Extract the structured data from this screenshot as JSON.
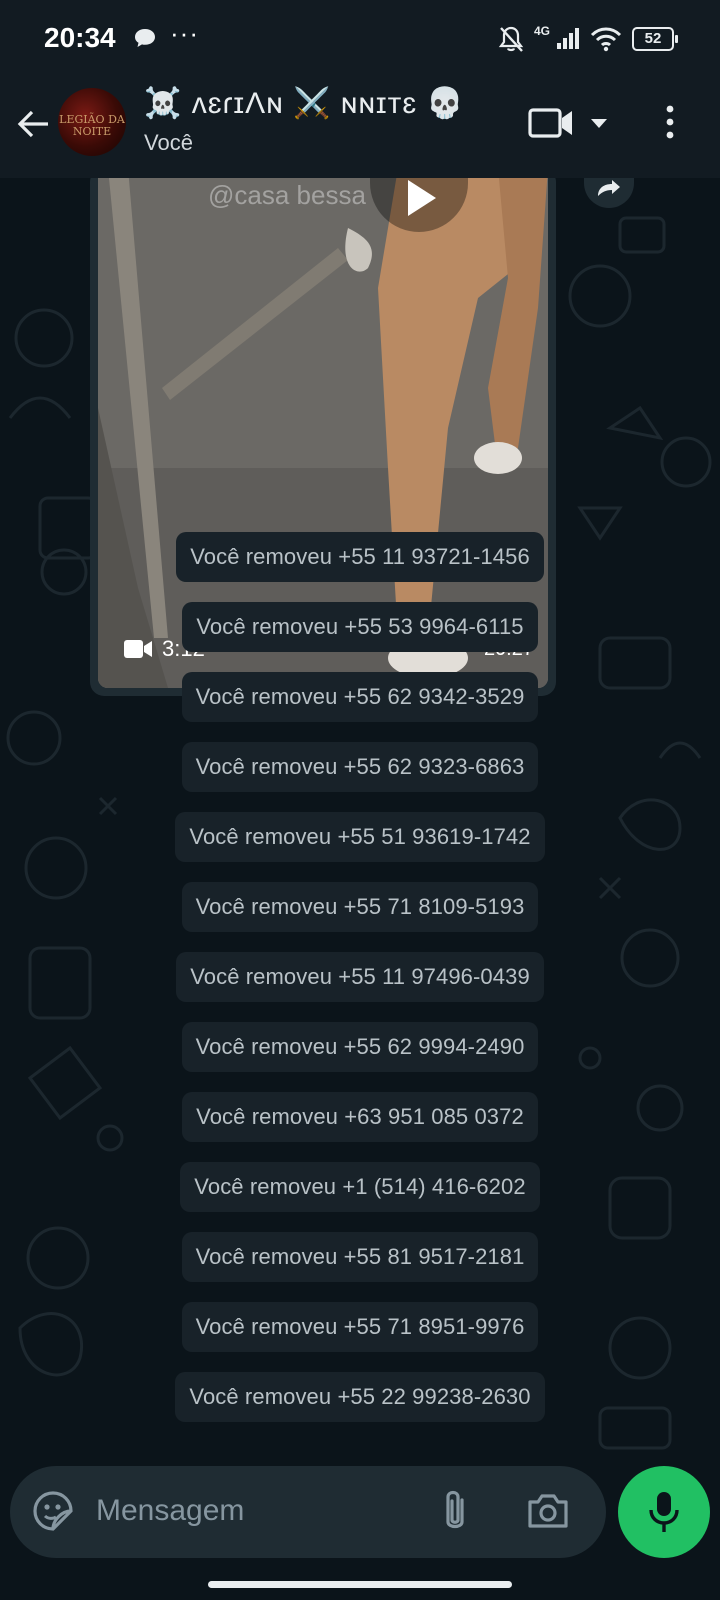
{
  "status_bar": {
    "time": "20:34",
    "dots": "···",
    "network": "4G",
    "battery": "52"
  },
  "header": {
    "group_name": "☠️ ʌɛɾɪɅɴ ⚔️ ɴɴɪтɛ 💀",
    "subtitle": "Você",
    "avatar_text": "LEGIÃO DA NOITE"
  },
  "video_message": {
    "watermark": "@casa   bessa",
    "duration": "3:12",
    "time": "20:27"
  },
  "system_messages": [
    "Você removeu +55 11 93721-1456",
    "Você removeu +55 53 9964-6115",
    "Você removeu +55 62 9342-3529",
    "Você removeu +55 62 9323-6863",
    "Você removeu +55 51 93619-1742",
    "Você removeu +55 71 8109-5193",
    "Você removeu +55 11 97496-0439",
    "Você removeu +55 62 9994-2490",
    "Você removeu +63 951 085 0372",
    "Você removeu +1 (514) 416-6202",
    "Você removeu +55 81 9517-2181",
    "Você removeu +55 71 8951-9976",
    "Você removeu +55 22 99238-2630"
  ],
  "composer": {
    "placeholder": "Mensagem"
  },
  "colors": {
    "background": "#0b141a",
    "bar": "#121b22",
    "bubble": "#182229",
    "input": "#1f2c33",
    "accent": "#21c063"
  }
}
